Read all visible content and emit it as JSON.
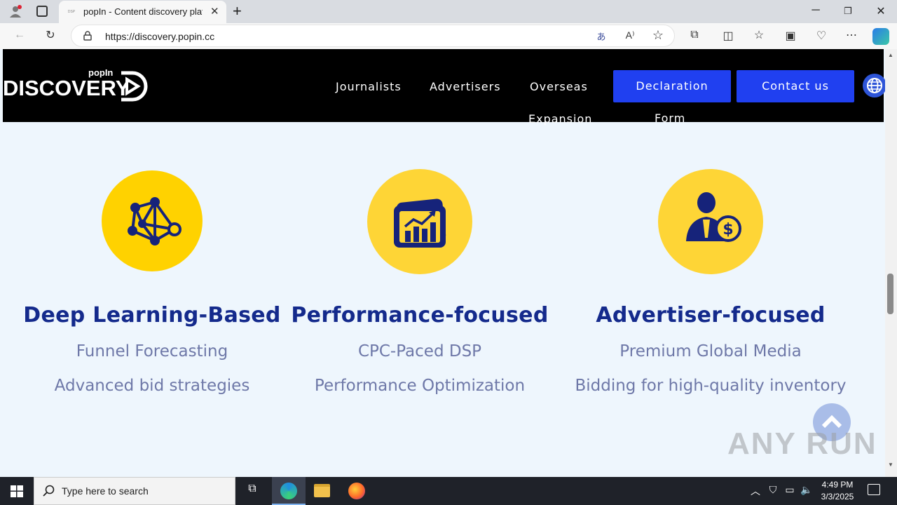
{
  "browser": {
    "tab_title": "popIn - Content discovery platfo",
    "tab_favicon": "DSP",
    "url": "https://discovery.popin.cc"
  },
  "header": {
    "logo_small": "popIn",
    "logo_big": "DISCOVERY",
    "nav": [
      "Journalists",
      "Advertisers",
      "Overseas",
      "Expansion"
    ],
    "cta_declaration_line1": "Declaration",
    "cta_declaration_line2": "Form",
    "cta_contact": "Contact us"
  },
  "features": [
    {
      "title": "Deep Learning-Based",
      "line1": "Funnel Forecasting",
      "line2": "Advanced bid strategies",
      "icon": "network-icon"
    },
    {
      "title": "Performance-focused",
      "line1": "CPC-Paced DSP",
      "line2": "Performance Optimization",
      "icon": "growth-chart-icon"
    },
    {
      "title": "Advertiser-focused",
      "line1": "Premium Global Media",
      "line2": "Bidding for high-quality inventory",
      "icon": "advertiser-dollar-icon"
    }
  ],
  "watermark": "ANY RUN",
  "taskbar": {
    "search_placeholder": "Type here to search",
    "time": "4:49 PM",
    "date": "3/3/2025"
  },
  "colors": {
    "accent_blue": "#2040f0",
    "title_navy": "#142a8c",
    "icon_yellow": "#fed536",
    "page_bg": "#eef6fd"
  }
}
